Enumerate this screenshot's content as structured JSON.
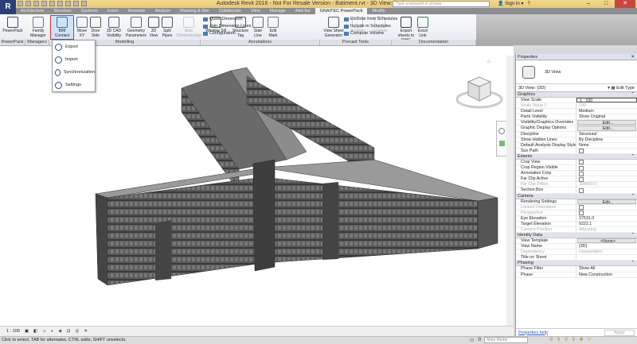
{
  "app": {
    "title": "Autodesk Revit 2016 -  Not For Resale Version -    Batiment.rvt - 3D View: {3D}",
    "logo": "R",
    "search_placeholder": "Type a keyword or phrase",
    "sign_in": "Sign In",
    "help": "?"
  },
  "tabs": [
    "Architecture",
    "Structure",
    "Systems",
    "Insert",
    "Annotate",
    "Analyze",
    "Massing & Site",
    "Collaborate",
    "View",
    "Manage",
    "Add-Ins",
    "GRAITEC PowerPack",
    "Modify"
  ],
  "active_tab": "GRAITEC PowerPack",
  "ribbon": {
    "buttons": [
      {
        "label": "PowerPack",
        "icon": "graitec-logo-icon"
      },
      {
        "label": "Family Manager",
        "icon": "folder-icon"
      },
      {
        "label": "BIM Connect",
        "icon": "bim-connect-icon"
      },
      {
        "label": "Move XY",
        "icon": "move-xy-icon"
      },
      {
        "label": "Door Side",
        "icon": "door-side-icon"
      },
      {
        "label": "3D CAD Visibility",
        "icon": "cad-visibility-icon"
      },
      {
        "label": "Geometry Parameters",
        "icon": "geometry-icon"
      },
      {
        "label": "3D View",
        "icon": "3d-view-icon"
      },
      {
        "label": "Split Pipes",
        "icon": "split-pipes-icon"
      },
      {
        "label": "Auto Dimensioning",
        "icon": "auto-dimension-icon",
        "disabled": true
      },
      {
        "label": "Window Sill",
        "icon": "window-sill-icon"
      },
      {
        "label": "Structure Tag",
        "icon": "structure-tag-icon"
      },
      {
        "label": "Stair Line",
        "icon": "stair-line-icon"
      },
      {
        "label": "Edit Mark",
        "icon": "edit-mark-icon"
      },
      {
        "label": "View Sheet Generator",
        "icon": "view-sheet-icon"
      },
      {
        "label": "Arrange",
        "icon": "arrange-icon",
        "disabled": true
      },
      {
        "label": "Legends",
        "icon": "legends-icon",
        "disabled": true
      },
      {
        "label": "Export sheets to DWG",
        "icon": "dwg-icon"
      },
      {
        "label": "Excel Link",
        "icon": "excel-icon"
      }
    ],
    "small": [
      "Quick Dimension",
      "Join Dimension Lines",
      "Configuration",
      "Exclude from Schedules",
      "Include in Schedules",
      "Compute Volume"
    ],
    "panels": [
      "PowerPack ▾",
      "Managers",
      "Modelling",
      "Annotations",
      "Precast Tools",
      "Documentation"
    ]
  },
  "bim_menu": [
    "Export",
    "Import",
    "Synchronization",
    "Settings"
  ],
  "properties": {
    "title": "Properties",
    "type": "3D View",
    "selector": "3D View: {3D}",
    "edit_type": "Edit Type",
    "groups": [
      {
        "name": "Graphics",
        "rows": [
          {
            "k": "View Scale",
            "v": "1 : 100",
            "kind": "input"
          },
          {
            "k": "Scale Value    1:",
            "v": "100",
            "dis": true
          },
          {
            "k": "Detail Level",
            "v": "Medium"
          },
          {
            "k": "Parts Visibility",
            "v": "Show Original"
          },
          {
            "k": "Visibility/Graphics Overrides",
            "v": "Edit...",
            "kind": "btn"
          },
          {
            "k": "Graphic Display Options",
            "v": "Edit...",
            "kind": "btn"
          },
          {
            "k": "Discipline",
            "v": "Structural"
          },
          {
            "k": "Show Hidden Lines",
            "v": "By Discipline"
          },
          {
            "k": "Default Analysis Display Style",
            "v": "None"
          },
          {
            "k": "Sun Path",
            "v": "",
            "kind": "cb"
          }
        ]
      },
      {
        "name": "Extents",
        "rows": [
          {
            "k": "Crop View",
            "v": "",
            "kind": "cb"
          },
          {
            "k": "Crop Region Visible",
            "v": "",
            "kind": "cb"
          },
          {
            "k": "Annotation Crop",
            "v": "",
            "kind": "cb"
          },
          {
            "k": "Far Clip Active",
            "v": "",
            "kind": "cb"
          },
          {
            "k": "Far Clip Offset",
            "v": "304800.0",
            "dis": true
          },
          {
            "k": "Section Box",
            "v": "",
            "kind": "cb"
          }
        ]
      },
      {
        "name": "Camera",
        "rows": [
          {
            "k": "Rendering Settings",
            "v": "Edit...",
            "kind": "btn"
          },
          {
            "k": "Locked Orientation",
            "v": "",
            "kind": "cb",
            "dis": true
          },
          {
            "k": "Perspective",
            "v": "",
            "kind": "cb",
            "dis": true
          },
          {
            "k": "Eye Elevation",
            "v": "37531.0"
          },
          {
            "k": "Target Elevation",
            "v": "9222.1"
          },
          {
            "k": "Camera Position",
            "v": "Adjusting",
            "dis": true
          }
        ]
      },
      {
        "name": "Identity Data",
        "rows": [
          {
            "k": "View Template",
            "v": "<None>",
            "kind": "btn"
          },
          {
            "k": "View Name",
            "v": "{3D}"
          },
          {
            "k": "Dependency",
            "v": "Independent",
            "dis": true
          },
          {
            "k": "Title on Sheet",
            "v": ""
          }
        ]
      },
      {
        "name": "Phasing",
        "rows": [
          {
            "k": "Phase Filter",
            "v": "Show All"
          },
          {
            "k": "Phase",
            "v": "New Construction"
          }
        ]
      }
    ],
    "help": "Properties help",
    "apply": "Apply"
  },
  "view_bar": {
    "scale": "1 : 100"
  },
  "status": {
    "text": "Click to select, TAB for alternates, CTRL adds, SHIFT unselects.",
    "workset_value": ":0",
    "model": "Main Model"
  },
  "viewcube": {
    "faces": [
      "TOP",
      "FRONT",
      "RIGHT"
    ]
  }
}
